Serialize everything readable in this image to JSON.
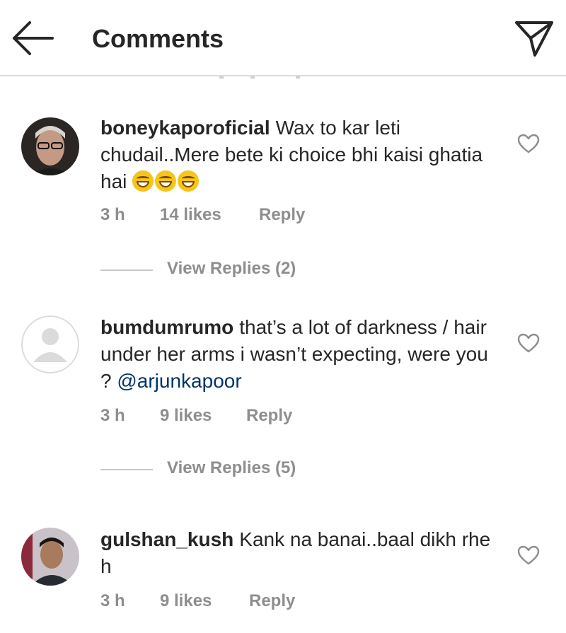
{
  "header": {
    "back_icon": "arrow-left-icon",
    "title": "Comments",
    "send_icon": "paper-plane-icon"
  },
  "comments": [
    {
      "username": "boneykaporoficial",
      "text": "Wax to kar leti chudail..Mere bete ki choice bhi kaisi ghatia hai",
      "emoji": [
        "grinning-squinting-face-emoji",
        "grinning-squinting-face-emoji",
        "grinning-squinting-face-emoji"
      ],
      "time": "3 h",
      "likes": "14 likes",
      "reply": "Reply",
      "view_replies": "View Replies (2)"
    },
    {
      "username": "bumdumrumo",
      "text": "that’s a lot of darkness / hair under her arms i wasn’t expecting, were you ? ",
      "mention": "@arjunkapoor",
      "time": "3 h",
      "likes": "9 likes",
      "reply": "Reply",
      "view_replies": "View Replies (5)"
    },
    {
      "username": "gulshan_kush",
      "text": "Kank na banai..baal dikh rhe h",
      "time": "3 h",
      "likes": "9 likes",
      "reply": "Reply"
    }
  ],
  "colors": {
    "text": "#262626",
    "meta": "#8e8e8e",
    "mention": "#003569",
    "divider": "#dbdbdb"
  }
}
